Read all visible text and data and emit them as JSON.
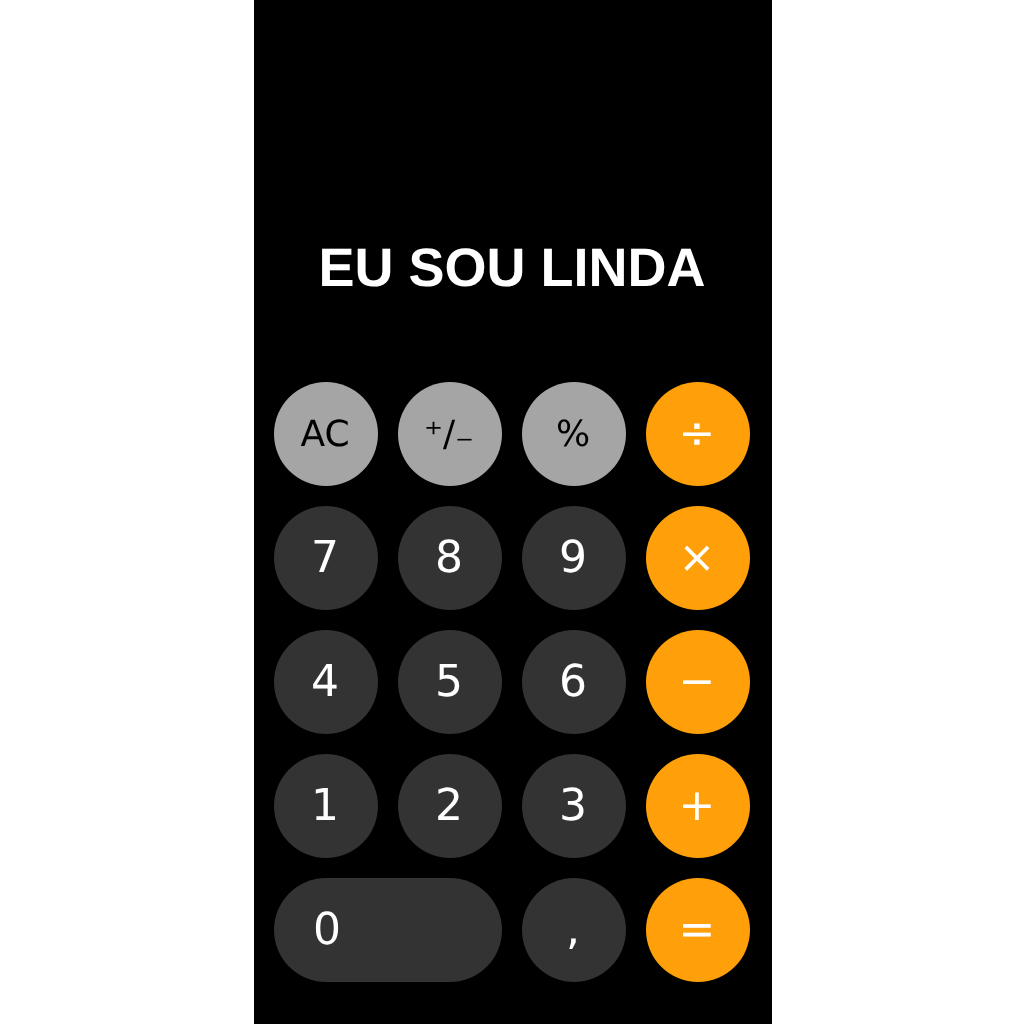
{
  "display": "EU SOU LINDA",
  "keys": [
    {
      "label": "AC",
      "kind": "function"
    },
    {
      "label": "⁺∕₋",
      "kind": "function"
    },
    {
      "label": "%",
      "kind": "function"
    },
    {
      "label": "÷",
      "kind": "operator"
    },
    {
      "label": "7",
      "kind": "digit"
    },
    {
      "label": "8",
      "kind": "digit"
    },
    {
      "label": "9",
      "kind": "digit"
    },
    {
      "label": "×",
      "kind": "operator"
    },
    {
      "label": "4",
      "kind": "digit"
    },
    {
      "label": "5",
      "kind": "digit"
    },
    {
      "label": "6",
      "kind": "digit"
    },
    {
      "label": "−",
      "kind": "operator"
    },
    {
      "label": "1",
      "kind": "digit"
    },
    {
      "label": "2",
      "kind": "digit"
    },
    {
      "label": "3",
      "kind": "digit"
    },
    {
      "label": "+",
      "kind": "operator"
    },
    {
      "label": "0",
      "kind": "wide"
    },
    {
      "label": ",",
      "kind": "digit"
    },
    {
      "label": "=",
      "kind": "operator"
    }
  ]
}
